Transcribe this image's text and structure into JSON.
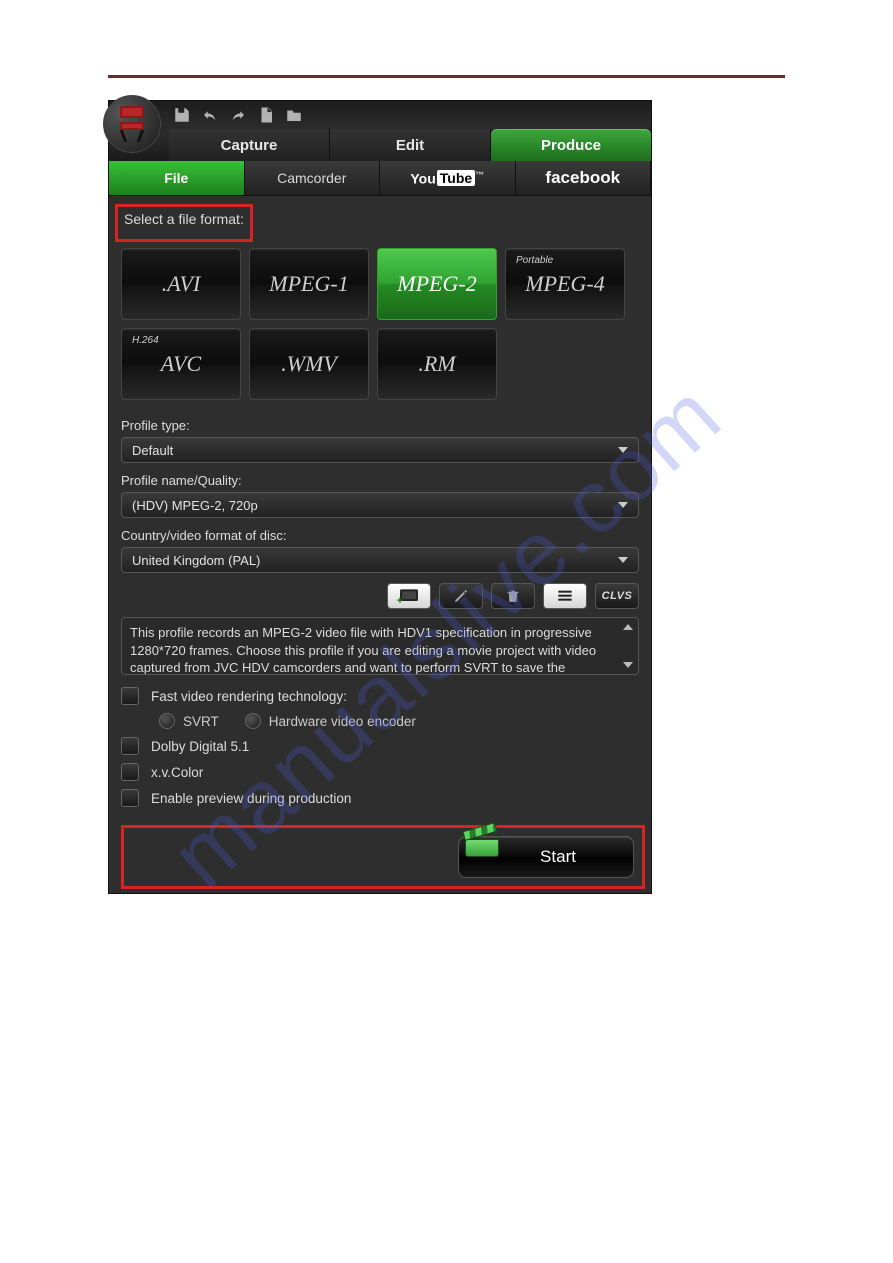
{
  "watermark": "manualslive.com",
  "topIcons": [
    "save-icon",
    "undo-icon",
    "redo-icon",
    "new-file-icon",
    "open-folder-icon"
  ],
  "mainTabs": {
    "capture": "Capture",
    "edit": "Edit",
    "produce": "Produce"
  },
  "subTabs": {
    "file": "File",
    "camcorder": "Camcorder",
    "youtube": {
      "you": "You",
      "tube": "Tube",
      "tm": "™"
    },
    "facebook": "facebook"
  },
  "sectionLabel": "Select a file format:",
  "formats": {
    "avi": ".AVI",
    "mpeg1": "MPEG-1",
    "mpeg2": "MPEG-2",
    "mpeg4_top": "Portable",
    "mpeg4": "MPEG-4",
    "h264_top": "H.264",
    "h264": "AVC",
    "wmv": ".WMV",
    "rm": ".RM"
  },
  "fields": {
    "profileTypeLabel": "Profile type:",
    "profileTypeValue": "Default",
    "profileNameLabel": "Profile name/Quality:",
    "profileNameValue": "(HDV) MPEG-2, 720p",
    "countryLabel": "Country/video format of disc:",
    "countryValue": "United Kingdom (PAL)"
  },
  "toolbar": {
    "clvs": "CLVS"
  },
  "description": "This profile records an MPEG-2 video file with HDV1 specification in progressive 1280*720 frames. Choose this profile if you are editing a movie project with video captured from JVC HDV camcorders and want to perform SVRT to save the",
  "options": {
    "fastRender": "Fast video rendering technology:",
    "svrt": "SVRT",
    "hwEncoder": "Hardware video encoder",
    "dolby": "Dolby Digital 5.1",
    "xvcolor": "x.v.Color",
    "preview": "Enable preview during production"
  },
  "startLabel": "Start"
}
